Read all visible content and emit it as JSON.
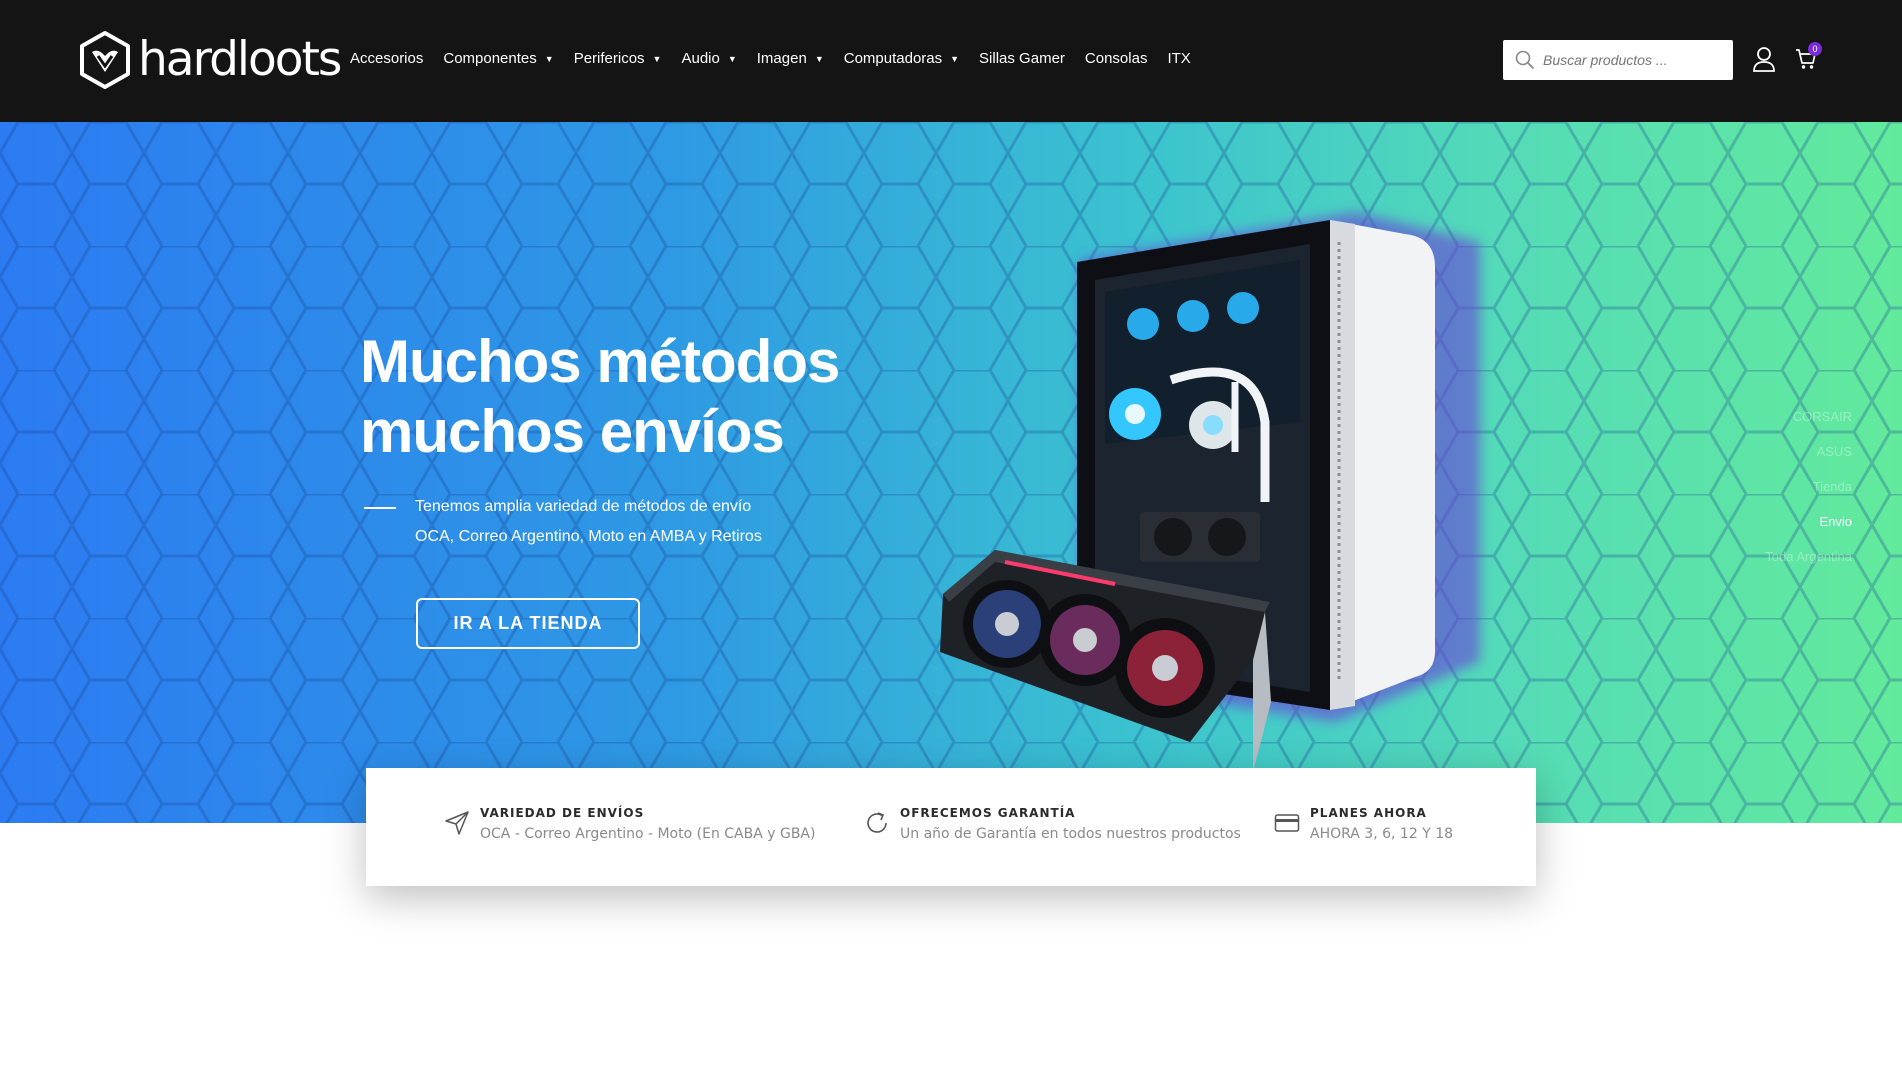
{
  "header": {
    "logo_text": "hardloots",
    "nav": [
      {
        "label": "Accesorios",
        "has_dropdown": false
      },
      {
        "label": "Componentes",
        "has_dropdown": true
      },
      {
        "label": "Perifericos",
        "has_dropdown": true
      },
      {
        "label": "Audio",
        "has_dropdown": true
      },
      {
        "label": "Imagen",
        "has_dropdown": true
      },
      {
        "label": "Computadoras",
        "has_dropdown": true
      },
      {
        "label": "Sillas Gamer",
        "has_dropdown": false
      },
      {
        "label": "Consolas",
        "has_dropdown": false
      },
      {
        "label": "ITX",
        "has_dropdown": false
      }
    ],
    "search_placeholder": "Buscar productos ...",
    "cart_count": "0"
  },
  "hero": {
    "title_line1": "Muchos métodos",
    "title_line2": "muchos envíos",
    "subtitle_line1": "Tenemos amplia variedad de métodos de envío",
    "subtitle_line2": "OCA, Correo Argentino, Moto en AMBA y Retiros",
    "button_label": "IR A LA TIENDA",
    "slider_items": [
      "CORSAIR",
      "ASUS",
      "Tienda",
      "Envio",
      "Toda Argentina"
    ],
    "active_slide": "Envio"
  },
  "features": [
    {
      "icon": "send-icon",
      "title": "VARIEDAD DE ENVÍOS",
      "desc": "OCA - Correo Argentino - Moto (En CABA y GBA)"
    },
    {
      "icon": "refresh-icon",
      "title": "OFRECEMOS GARANTÍA",
      "desc": "Un año de Garantía en todos nuestros productos"
    },
    {
      "icon": "credit-card-icon",
      "title": "PLANES AHORA",
      "desc": "AHORA 3, 6, 12 Y 18"
    }
  ],
  "colors": {
    "header_bg": "#141414",
    "hero_gradient_start": "#2c7bf2",
    "hero_gradient_end": "#62ea9c",
    "badge": "#7b2cd9"
  }
}
